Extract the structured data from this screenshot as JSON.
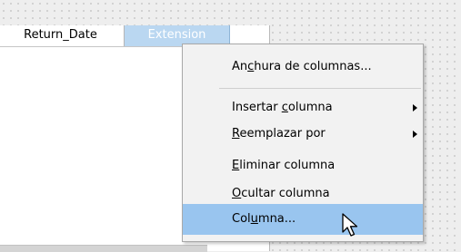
{
  "columns": {
    "headers": [
      "Return_Date",
      "Extension",
      ""
    ]
  },
  "context_menu": {
    "items": [
      {
        "pre": "An",
        "key": "c",
        "post": "hura de columnas...",
        "submenu": false
      },
      {
        "pre": "Insertar ",
        "key": "c",
        "post": "olumna",
        "submenu": true
      },
      {
        "pre": "",
        "key": "R",
        "post": "eemplazar por",
        "submenu": true
      },
      {
        "pre": "",
        "key": "E",
        "post": "liminar columna",
        "submenu": false
      },
      {
        "pre": "",
        "key": "O",
        "post": "cultar columna",
        "submenu": false
      },
      {
        "pre": "Col",
        "key": "u",
        "post": "mna...",
        "submenu": false
      }
    ],
    "highlighted_index": 5
  },
  "icons": {
    "cursor": "mouse-pointer-icon",
    "submenu": "chevron-right-icon"
  },
  "colors": {
    "selected_header": "#bad7f1",
    "menu_highlight": "#99c5ef",
    "menu_background": "#f2f2f2"
  }
}
